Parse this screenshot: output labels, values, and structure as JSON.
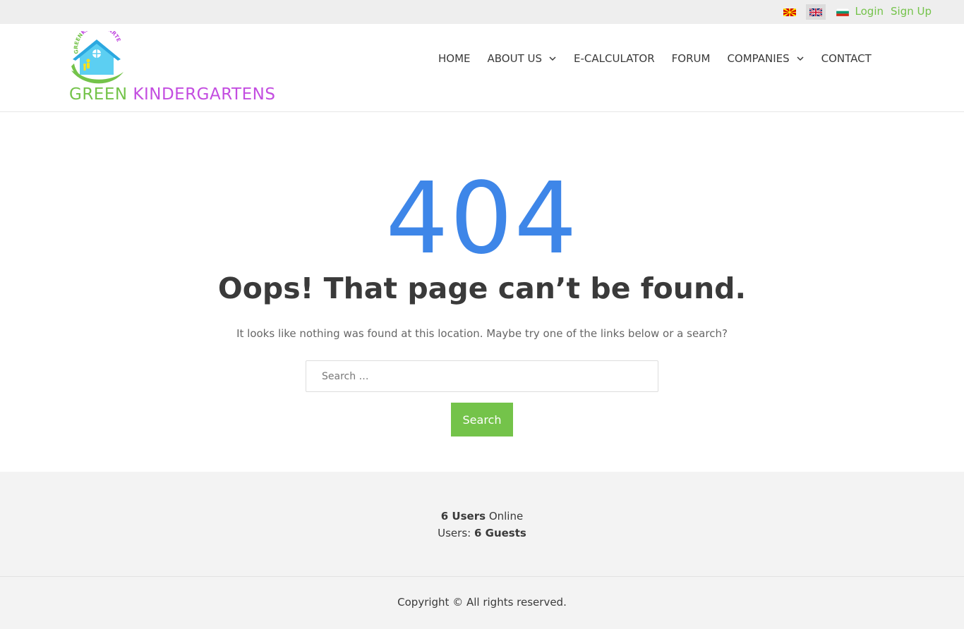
{
  "topbar": {
    "languages": [
      {
        "code": "mk",
        "active": false
      },
      {
        "code": "en",
        "active": true
      },
      {
        "code": "bg",
        "active": false
      }
    ],
    "login_label": "Login",
    "signup_label": "Sign Up",
    "link_color": "#74c34a"
  },
  "header": {
    "logo_text": "GREENKINDERGARTENS",
    "title_part1": "GREEN",
    "title_part2": "KINDERGARTENS",
    "nav": [
      {
        "label": "HOME",
        "has_dropdown": false
      },
      {
        "label": "ABOUT US",
        "has_dropdown": true
      },
      {
        "label": "E-CALCULATOR",
        "has_dropdown": false
      },
      {
        "label": "FORUM",
        "has_dropdown": false
      },
      {
        "label": "COMPANIES",
        "has_dropdown": true
      },
      {
        "label": "CONTACT",
        "has_dropdown": false
      }
    ]
  },
  "main": {
    "code": "404",
    "heading": "Oops! That page can’t be found.",
    "description": "It looks like nothing was found at this location. Maybe try one of the links below or a search?",
    "search_placeholder": "Search …",
    "search_button": "Search",
    "accent_color": "#3e86e8"
  },
  "footer": {
    "online_count": "6 Users",
    "online_suffix": "Online",
    "users_prefix": "Users:",
    "guests_count": "6 Guests",
    "copyright": "Copyright © All rights reserved."
  },
  "colors": {
    "green": "#74c34a",
    "purple": "#c34de0",
    "blue": "#3e86e8"
  }
}
